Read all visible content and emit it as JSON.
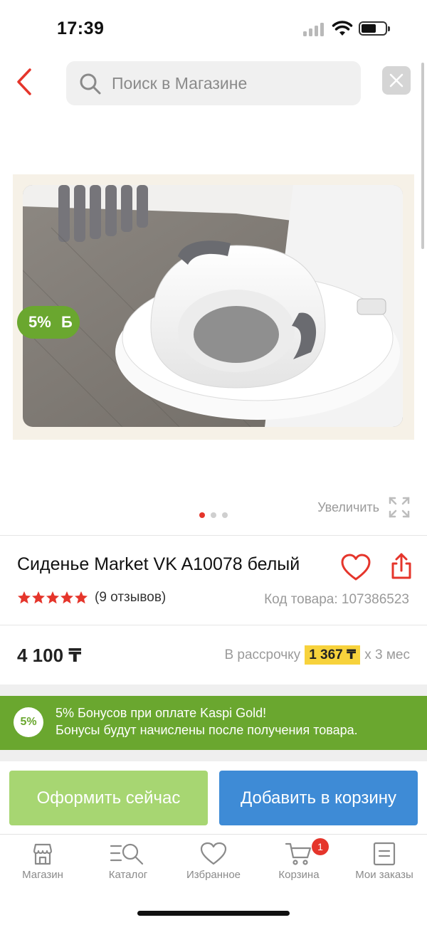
{
  "status_bar": {
    "time": "17:39"
  },
  "header": {
    "search_placeholder": "Поиск в Магазине",
    "back_icon": "chevron-left-icon",
    "clear_icon": "close-icon"
  },
  "gallery": {
    "bonus_badge_percent": "5%",
    "bonus_badge_currency": "Б",
    "zoom_label": "Увеличить",
    "slides_total": 3,
    "active_slide": 1
  },
  "product": {
    "title": "Сиденье Market VK A10078 белый",
    "rating_stars": 5,
    "reviews": "(9 отзывов)",
    "code": "Код товара: 107386523",
    "price": "4 100 ₸",
    "installment_prefix": "В рассрочку",
    "installment_amount": "1 367 ₸",
    "installment_suffix": "x 3 мес"
  },
  "bonus": {
    "circle_text": "5%",
    "line1": "5% Бонусов при оплате Kaspi Gold!",
    "line2": "Бонусы будут начислены после получения товара."
  },
  "actions": {
    "buy_now": "Оформить сейчас",
    "add_to_cart": "Добавить в корзину"
  },
  "tab_bar": {
    "items": [
      {
        "label": "Магазин",
        "icon": "store-icon"
      },
      {
        "label": "Каталог",
        "icon": "catalog-search-icon"
      },
      {
        "label": "Избранное",
        "icon": "heart-icon"
      },
      {
        "label": "Корзина",
        "icon": "cart-icon"
      },
      {
        "label": "Мои заказы",
        "icon": "orders-icon"
      }
    ],
    "cart_count": "1"
  },
  "colors": {
    "accent_red": "#e5352b",
    "bonus_green": "#6aa72f",
    "buy_green": "#a7d672",
    "cart_blue": "#3e8bd6",
    "installment_yellow": "#f7d23c"
  }
}
